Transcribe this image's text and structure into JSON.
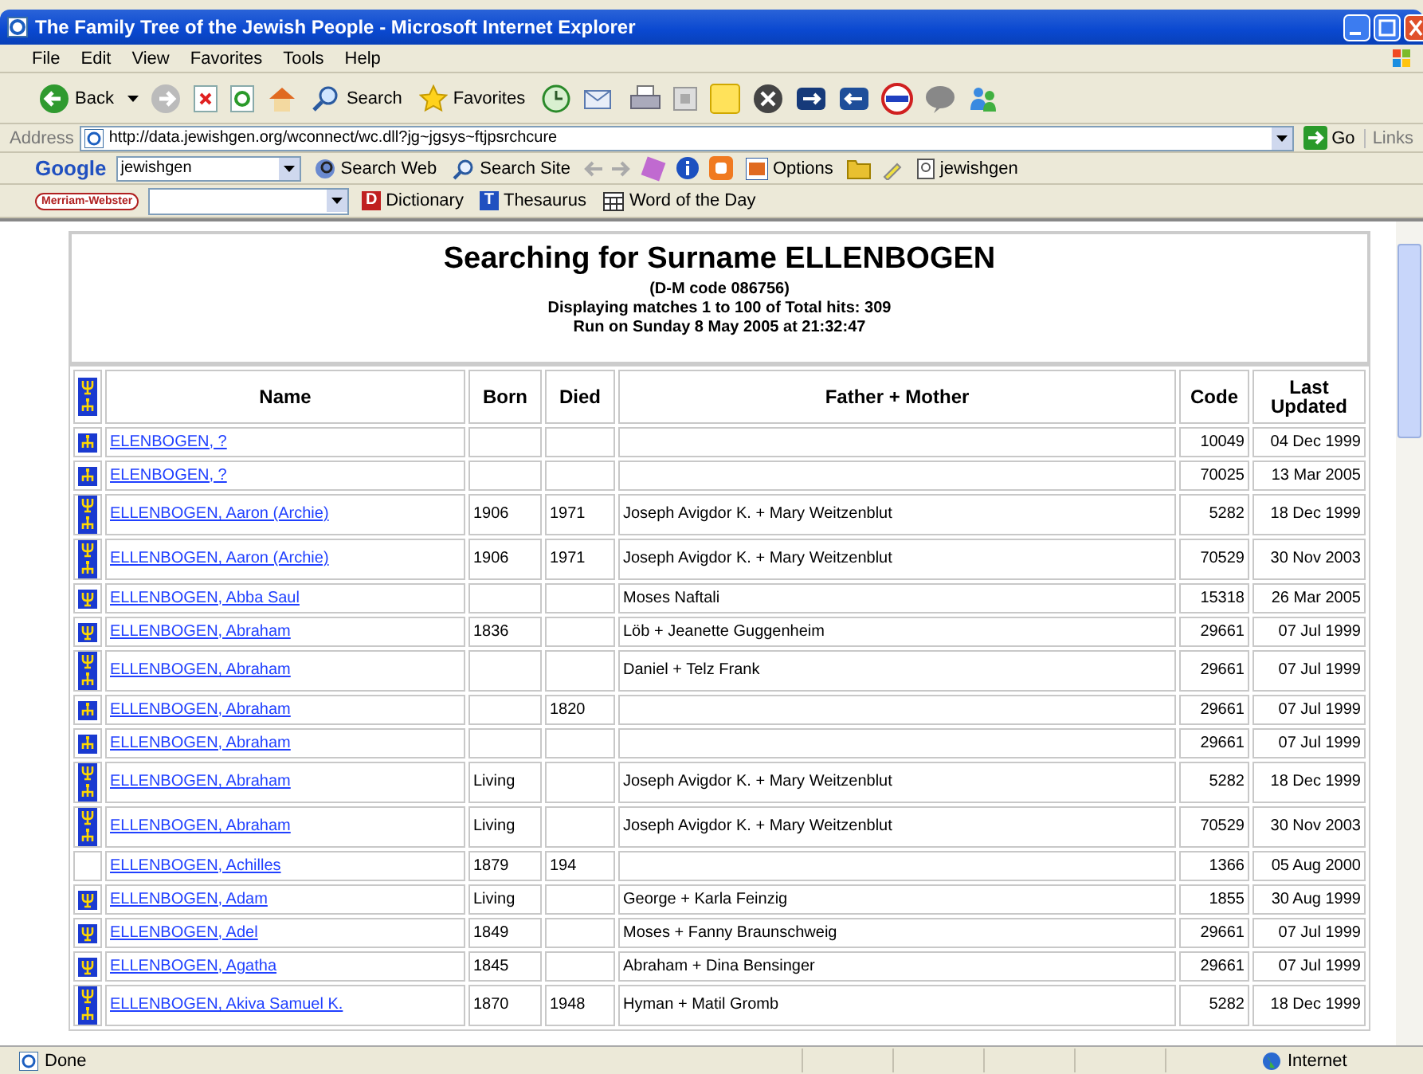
{
  "window": {
    "title": "The Family Tree of the Jewish People - Microsoft Internet Explorer"
  },
  "menu": [
    "File",
    "Edit",
    "View",
    "Favorites",
    "Tools",
    "Help"
  ],
  "toolbar": {
    "back": "Back",
    "search": "Search",
    "favorites": "Favorites"
  },
  "address": {
    "label": "Address",
    "url": "http://data.jewishgen.org/wconnect/wc.dll?jg~jgsys~ftjpsrchcure",
    "go": "Go",
    "links": "Links"
  },
  "google_bar": {
    "logo": "Google",
    "query": "jewishgen",
    "search_web": "Search Web",
    "search_site": "Search Site",
    "options": "Options",
    "site": "jewishgen"
  },
  "dictionary_bar": {
    "logo": "Merriam-Webster",
    "dictionary_icon": "D",
    "thesaurus_icon": "T",
    "dictionary": "Dictionary",
    "thesaurus": "Thesaurus",
    "word_of_day": "Word of the Day"
  },
  "page": {
    "heading": "Searching for Surname ELLENBOGEN",
    "lines": [
      "(D-M code 086756)",
      "Displaying matches 1 to 100 of Total hits: 309",
      "Run on Sunday 8 May 2005 at 21:32:47"
    ]
  },
  "table": {
    "columns": [
      "Name",
      "Born",
      "Died",
      "Father + Mother",
      "Code",
      "Last Updated"
    ],
    "rows": [
      {
        "kind": "descendants",
        "name": "ELENBOGEN, ?",
        "born": "",
        "died": "",
        "parents": "",
        "code": "10049",
        "updated": "04 Dec 1999"
      },
      {
        "kind": "descendants",
        "name": "ELENBOGEN, ?",
        "born": "",
        "died": "",
        "parents": "",
        "code": "70025",
        "updated": "13 Mar 2005"
      },
      {
        "kind": "both",
        "name": "ELLENBOGEN, Aaron (Archie)",
        "born": "1906",
        "died": "1971",
        "parents": "Joseph Avigdor K. + Mary Weitzenblut",
        "code": "5282",
        "updated": "18 Dec 1999"
      },
      {
        "kind": "both",
        "name": "ELLENBOGEN, Aaron (Archie)",
        "born": "1906",
        "died": "1971",
        "parents": "Joseph Avigdor K. + Mary Weitzenblut",
        "code": "70529",
        "updated": "30 Nov 2003"
      },
      {
        "kind": "ancestors",
        "name": "ELLENBOGEN, Abba Saul",
        "born": "",
        "died": "",
        "parents": "Moses Naftali",
        "code": "15318",
        "updated": "26 Mar 2005"
      },
      {
        "kind": "ancestors",
        "name": "ELLENBOGEN, Abraham",
        "born": "1836",
        "died": "",
        "parents": "Löb + Jeanette Guggenheim",
        "code": "29661",
        "updated": "07 Jul 1999"
      },
      {
        "kind": "both",
        "name": "ELLENBOGEN, Abraham",
        "born": "",
        "died": "",
        "parents": "Daniel + Telz Frank",
        "code": "29661",
        "updated": "07 Jul 1999"
      },
      {
        "kind": "descendants",
        "name": "ELLENBOGEN, Abraham",
        "born": "",
        "died": "1820",
        "parents": "",
        "code": "29661",
        "updated": "07 Jul 1999"
      },
      {
        "kind": "descendants",
        "name": "ELLENBOGEN, Abraham",
        "born": "",
        "died": "",
        "parents": "",
        "code": "29661",
        "updated": "07 Jul 1999"
      },
      {
        "kind": "both",
        "name": "ELLENBOGEN, Abraham",
        "born": "Living",
        "died": "",
        "parents": "Joseph Avigdor K. + Mary Weitzenblut",
        "code": "5282",
        "updated": "18 Dec 1999"
      },
      {
        "kind": "both",
        "name": "ELLENBOGEN, Abraham",
        "born": "Living",
        "died": "",
        "parents": "Joseph Avigdor K. + Mary Weitzenblut",
        "code": "70529",
        "updated": "30 Nov 2003"
      },
      {
        "kind": "none",
        "name": "ELLENBOGEN, Achilles",
        "born": "1879",
        "died": "194",
        "parents": "",
        "code": "1366",
        "updated": "05 Aug 2000"
      },
      {
        "kind": "ancestors",
        "name": "ELLENBOGEN, Adam",
        "born": "Living",
        "died": "",
        "parents": "George + Karla Feinzig",
        "code": "1855",
        "updated": "30 Aug 1999"
      },
      {
        "kind": "ancestors",
        "name": "ELLENBOGEN, Adel",
        "born": "1849",
        "died": "",
        "parents": "Moses + Fanny Braunschweig",
        "code": "29661",
        "updated": "07 Jul 1999"
      },
      {
        "kind": "ancestors",
        "name": "ELLENBOGEN, Agatha",
        "born": "1845",
        "died": "",
        "parents": "Abraham + Dina Bensinger",
        "code": "29661",
        "updated": "07 Jul 1999"
      },
      {
        "kind": "both",
        "name": "ELLENBOGEN, Akiva Samuel K.",
        "born": "1870",
        "died": "1948",
        "parents": "Hyman + Matil Gromb",
        "code": "5282",
        "updated": "18 Dec 1999"
      }
    ]
  },
  "status_bar": {
    "text": "Done",
    "zone": "Internet"
  }
}
